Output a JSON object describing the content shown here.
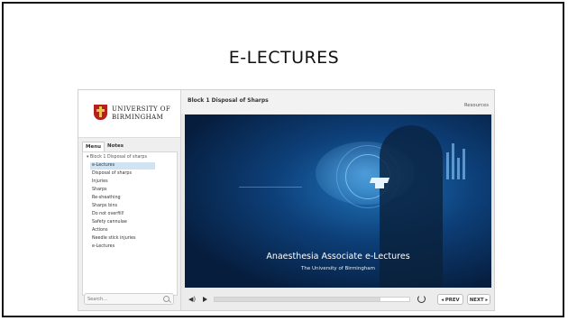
{
  "page": {
    "title": "E-LECTURES"
  },
  "sidebar": {
    "logo_line1": "UNIVERSITY OF",
    "logo_line2": "BIRMINGHAM",
    "tabs": [
      "Menu",
      "Notes"
    ],
    "menu": {
      "group": "▾ Block 1 Disposal of sharps",
      "items": [
        "e-Lectures",
        "Disposal of sharps",
        "Injuries",
        "Sharps",
        "Re-sheathing",
        "Sharps bins",
        "Do not overfill!",
        "Safety cannulae",
        "Actions",
        "Needle stick injuries",
        "e-Lectures"
      ],
      "selected_index": 0
    },
    "search": {
      "placeholder": "Search..."
    }
  },
  "header": {
    "slide_title": "Block 1 Disposal of Sharps",
    "resources": "Resources"
  },
  "slide": {
    "title": "Anaesthesia Associate e-Lectures",
    "subtitle": "The University of Birmingham"
  },
  "controls": {
    "prev": "◂ PREV",
    "next": "NEXT ▸",
    "progress": 0.85
  },
  "colors": {
    "selected_bg": "#cfe3f2",
    "slide_dark": "#061d3d",
    "crest": "#b22222"
  },
  "icons": {
    "volume": "volume-icon",
    "play": "play-icon",
    "replay": "replay-icon",
    "search": "search-icon"
  }
}
